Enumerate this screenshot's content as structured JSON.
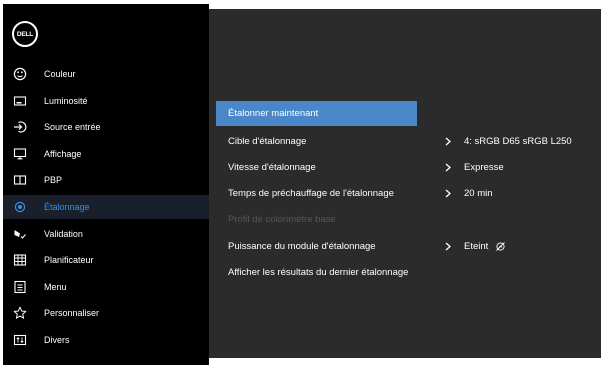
{
  "brand": {
    "logo_text": "DELL"
  },
  "sidebar": {
    "items": [
      {
        "label": "Couleur",
        "icon": "palette-icon"
      },
      {
        "label": "Luminosité",
        "icon": "brightness-icon"
      },
      {
        "label": "Source entrée",
        "icon": "input-source-icon"
      },
      {
        "label": "Affichage",
        "icon": "display-icon"
      },
      {
        "label": "PBP",
        "icon": "pbp-icon"
      },
      {
        "label": "Étalonnage",
        "icon": "calibration-icon",
        "selected": true
      },
      {
        "label": "Validation",
        "icon": "validation-icon"
      },
      {
        "label": "Planificateur",
        "icon": "scheduler-icon"
      },
      {
        "label": "Menu",
        "icon": "menu-icon"
      },
      {
        "label": "Personnaliser",
        "icon": "star-icon"
      },
      {
        "label": "Divers",
        "icon": "others-icon"
      }
    ]
  },
  "main": {
    "items": [
      {
        "label": "Étalonner maintenant",
        "highlighted": true
      },
      {
        "label": "Cible d'étalonnage",
        "value": "4: sRGB D65 sRGB L250",
        "submenu": true
      },
      {
        "label": "Vitesse d'étalonnage",
        "value": "Expresse",
        "submenu": true
      },
      {
        "label": "Temps de préchauffage de l'étalonnage",
        "value": "20 min",
        "submenu": true
      },
      {
        "label": "Profil de colorimètre basé",
        "disabled": true
      },
      {
        "label": "Puissance du module d'étalonnage",
        "value": "Eteint",
        "value_icon": "power-off-icon",
        "submenu": true
      },
      {
        "label": "Afficher les résultats du dernier étalonnage"
      }
    ]
  },
  "colors": {
    "sidebar_bg": "#000000",
    "panel_bg": "#2b2b2b",
    "selected_text": "#3b8fe0",
    "highlight_bg": "#4a87c9",
    "disabled_text": "#565656",
    "text": "#ffffff"
  }
}
